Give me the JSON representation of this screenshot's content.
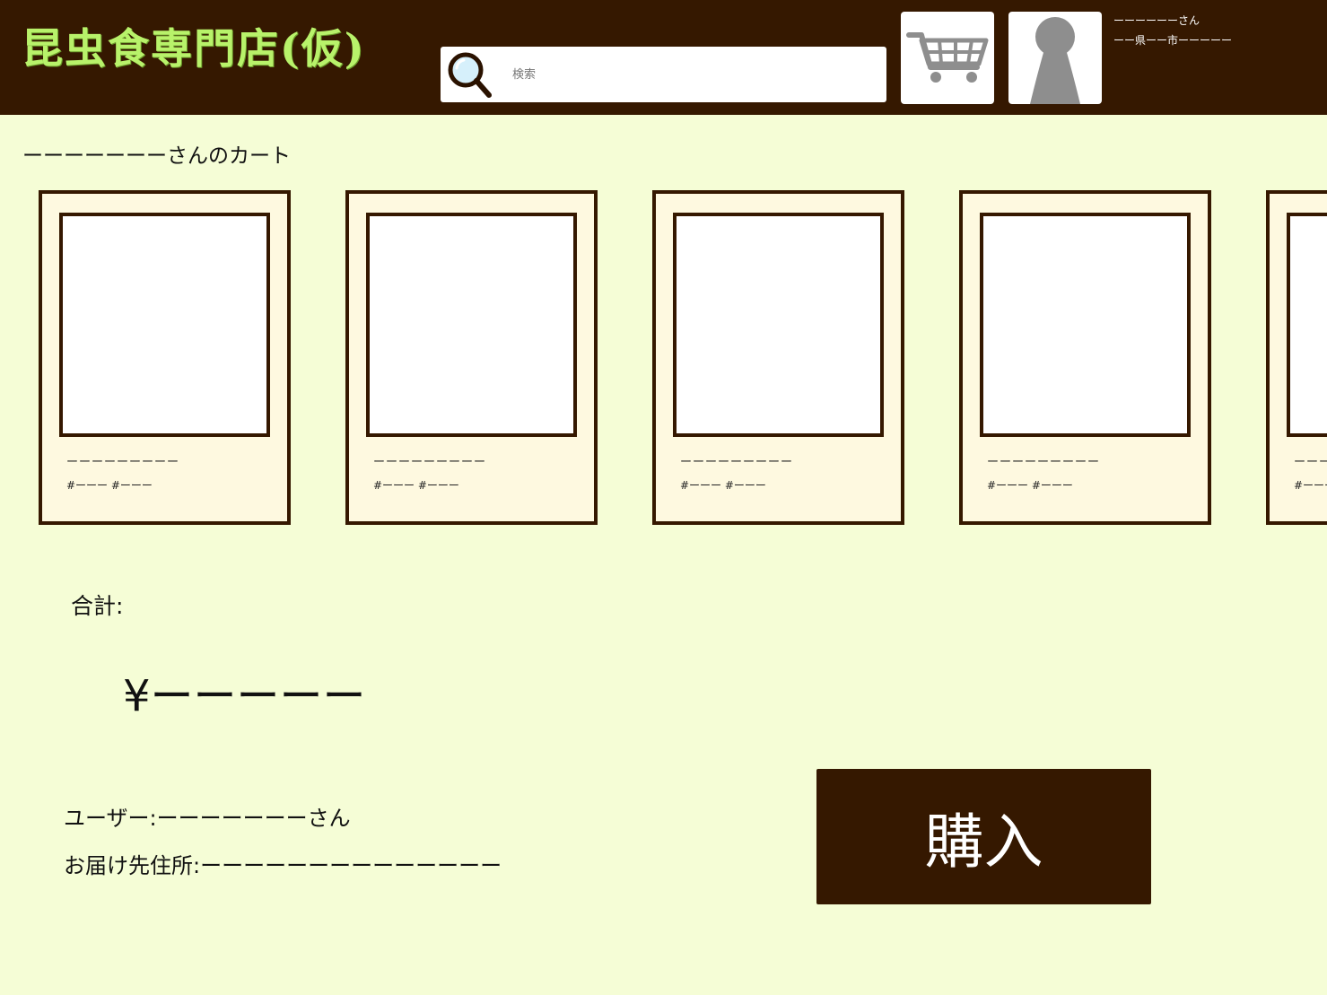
{
  "header": {
    "logo_text": "昆虫食専門店(仮)",
    "search": {
      "placeholder": "検索"
    },
    "user": {
      "name_line": "ーーーーーーさん",
      "address_line": "ーー県ーー市ーーーーー"
    }
  },
  "cart": {
    "title": "ーーーーーーーさんのカート",
    "items": [
      {
        "name": "ーーーーーーーーー",
        "tags": "#ーーー #ーーー"
      },
      {
        "name": "ーーーーーーーーー",
        "tags": "#ーーー #ーーー"
      },
      {
        "name": "ーーーーーーーーー",
        "tags": "#ーーー #ーーー"
      },
      {
        "name": "ーーーーーーーーー",
        "tags": "#ーーー #ーーー"
      },
      {
        "name": "ーーーーーーーーー",
        "tags": "#ーーー #ーーー"
      }
    ]
  },
  "summary": {
    "total_label": "合計:",
    "total_value": "¥ーーーーー",
    "user_line": "ユーザー:ーーーーーーーさん",
    "address_line": "お届け先住所:ーーーーーーーーーーーーーー"
  },
  "actions": {
    "buy_label": "購入"
  },
  "colors": {
    "header_bg": "#351800",
    "page_bg": "#f5fdd6",
    "card_bg": "#fef9e0",
    "logo": "#b8f26a"
  }
}
